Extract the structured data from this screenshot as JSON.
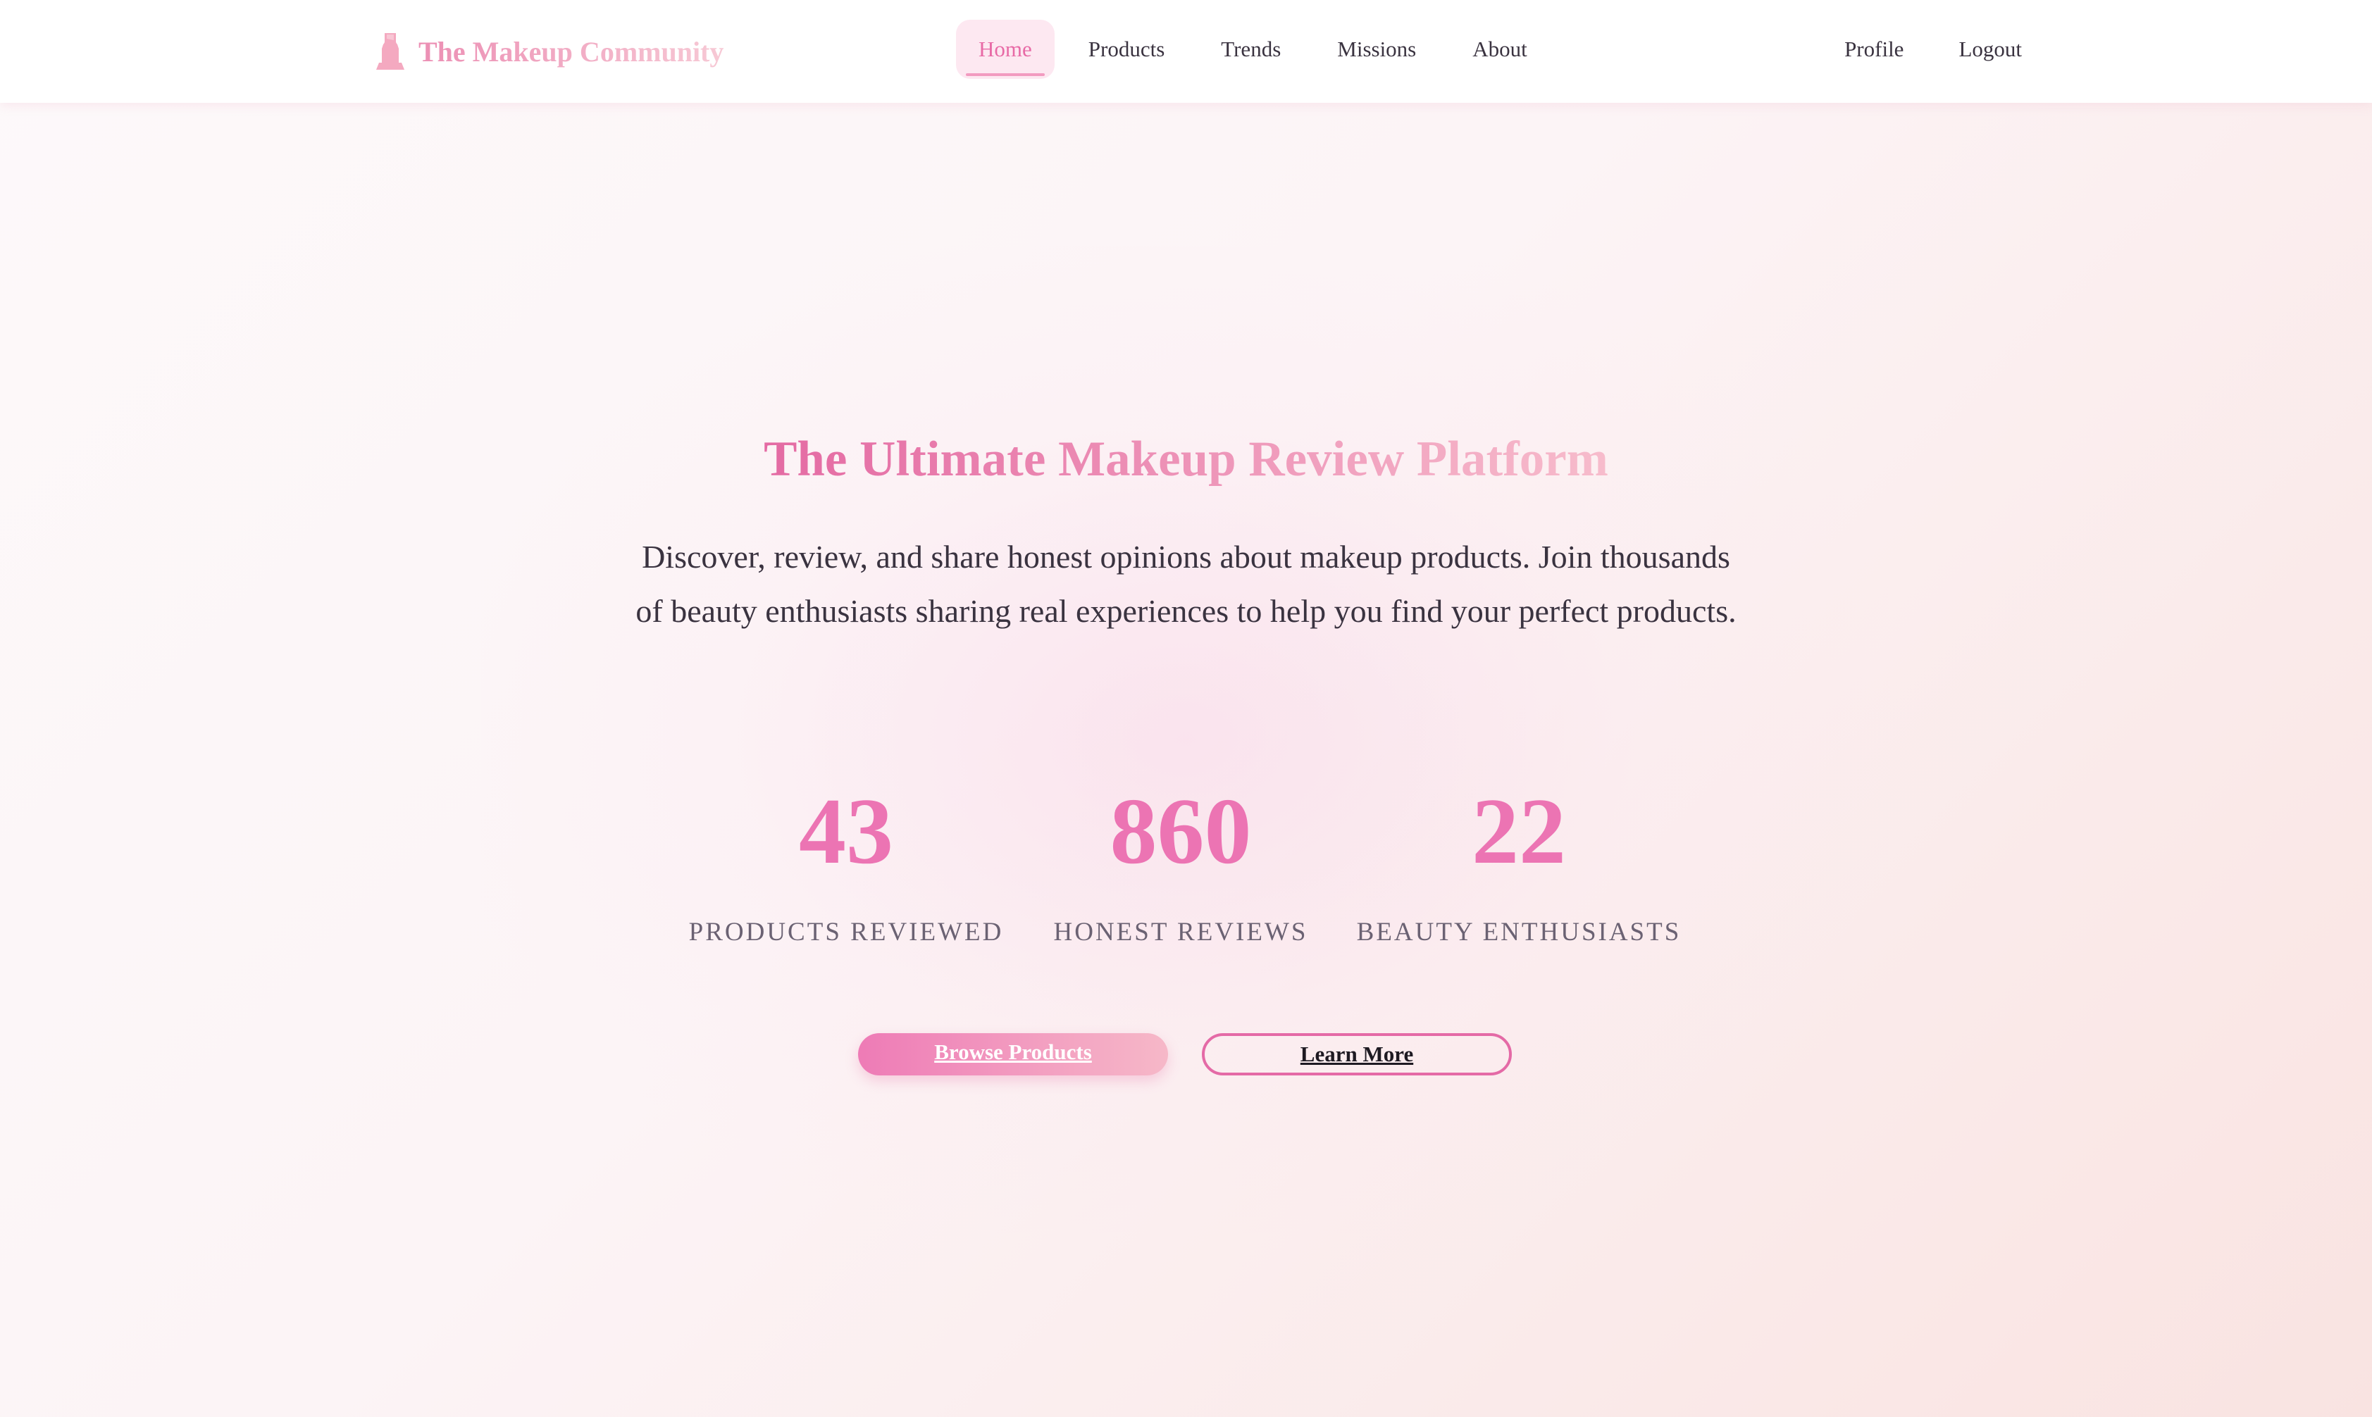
{
  "colors": {
    "accent": "#ec74b3",
    "accent_light": "#f7c9d5",
    "text": "#3a3340",
    "muted": "#6b6273"
  },
  "nav": {
    "brand": {
      "icon": "lipstick-icon",
      "name": "The Makeup Community"
    },
    "links": [
      "Home",
      "Products",
      "Trends",
      "Missions",
      "About"
    ],
    "active": "Home",
    "right_links": [
      "Profile",
      "Logout"
    ]
  },
  "hero": {
    "title": "The Ultimate Makeup Review Platform",
    "description": "Discover, review, and share honest opinions about makeup products. Join thousands of beauty enthusiasts sharing real experiences to help you find your perfect products.",
    "stats": [
      {
        "number": "43",
        "label": "PRODUCTS REVIEWED"
      },
      {
        "number": "860",
        "label": "HONEST REVIEWS"
      },
      {
        "number": "22",
        "label": "BEAUTY ENTHUSIASTS"
      }
    ],
    "buttons": {
      "primary": "Browse Products",
      "secondary": "Learn More"
    }
  }
}
